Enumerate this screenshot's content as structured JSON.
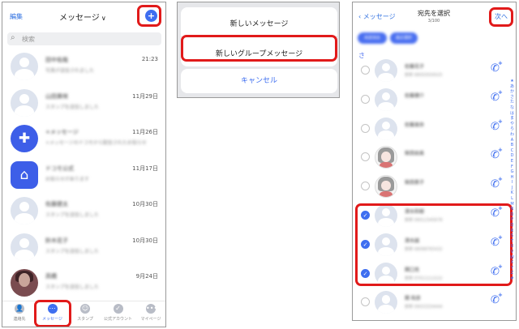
{
  "panel1": {
    "edit_label": "編集",
    "title": "メッセージ",
    "title_chevron": "∨",
    "new_button_glyph": "+",
    "search_placeholder": "検索",
    "conversations": [
      {
        "name": "田中佑哉",
        "preview": "写真が送信されました",
        "time": "21:23",
        "avatar": "default"
      },
      {
        "name": "山田美咲",
        "preview": "スタンプを送信しました",
        "time": "11月29日",
        "avatar": "default"
      },
      {
        "name": "+メッセージ",
        "preview": "+メッセージのドコモから配信されたお知らせ",
        "time": "11月26日",
        "avatar": "plus-message-app"
      },
      {
        "name": "ドコモ公式",
        "preview": "お知らせがあります",
        "time": "11月17日",
        "avatar": "home-app"
      },
      {
        "name": "佐藤健太",
        "preview": "スタンプを送信しました",
        "time": "10月30日",
        "avatar": "default"
      },
      {
        "name": "鈴木花子",
        "preview": "スタンプを送信しました",
        "time": "10月30日",
        "avatar": "default"
      },
      {
        "name": "高橋",
        "preview": "スタンプを送信しました",
        "time": "9月24日",
        "avatar": "photo"
      }
    ],
    "tabs": [
      {
        "label": "連絡先",
        "icon": "contacts-icon",
        "active": false
      },
      {
        "label": "メッセージ",
        "icon": "message-icon",
        "active": true
      },
      {
        "label": "スタンプ",
        "icon": "sticker-icon",
        "active": false
      },
      {
        "label": "公式アカウント",
        "icon": "official-account-icon",
        "active": false
      },
      {
        "label": "マイページ",
        "icon": "more-icon",
        "active": false
      }
    ]
  },
  "panel2": {
    "option_new_message": "新しいメッセージ",
    "option_new_group": "新しいグループメッセージ",
    "cancel_label": "キャンセル"
  },
  "panel3": {
    "back_label": "メッセージ",
    "title": "宛先を選択",
    "count": "3/100",
    "next_label": "次へ",
    "chips": [
      "未読消去",
      "最近選択"
    ],
    "section_header": "さ",
    "contacts": [
      {
        "name": "佐藤花子",
        "sub": "携帯 08050500025",
        "checked": false,
        "avatar": "default"
      },
      {
        "name": "佐藤健介",
        "sub": "",
        "checked": false,
        "avatar": "default"
      },
      {
        "name": "佐藤美奈",
        "sub": "",
        "checked": false,
        "avatar": "default"
      },
      {
        "name": "柴田由美",
        "sub": "",
        "checked": false,
        "avatar": "sketch"
      },
      {
        "name": "柴田恵子",
        "sub": "",
        "checked": false,
        "avatar": "sketch"
      },
      {
        "name": "清水和樹",
        "sub": "携帯 09012345678",
        "checked": true,
        "avatar": "default"
      },
      {
        "name": "清水誠",
        "sub": "携帯 08098765432",
        "checked": true,
        "avatar": "default"
      },
      {
        "name": "関口亮",
        "sub": "携帯 07011112222",
        "checked": true,
        "avatar": "default"
      },
      {
        "name": "関 和彦",
        "sub": "携帯 09033334444",
        "checked": false,
        "avatar": "default"
      }
    ],
    "index_letters": [
      "★",
      "あ",
      "か",
      "さ",
      "た",
      "な",
      "は",
      "ま",
      "や",
      "ら",
      "わ",
      "A",
      "B",
      "C",
      "D",
      "E",
      "F",
      "G",
      "H",
      "I",
      "J",
      "K",
      "L",
      "M",
      "N",
      "O",
      "P",
      "Q",
      "R",
      "S",
      "T",
      "U",
      "V",
      "W",
      "X",
      "Y",
      "Z",
      "#"
    ]
  },
  "colors": {
    "accent": "#3e6ef0",
    "highlight": "#e11a1a",
    "link": "#2e6fe0"
  }
}
